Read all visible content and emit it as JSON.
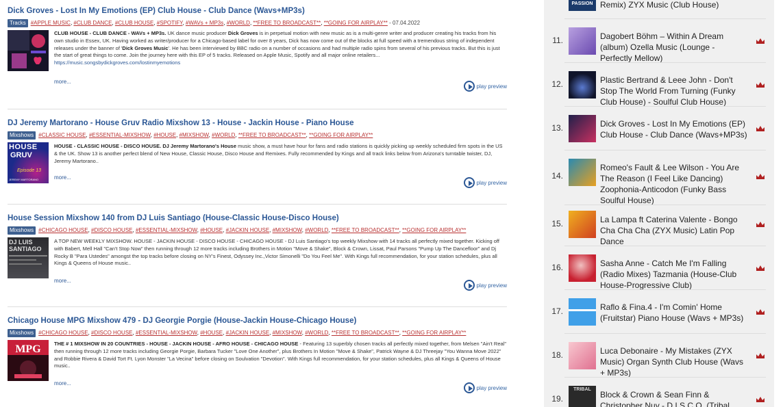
{
  "posts": [
    {
      "title": "Dick Groves - Lost In My Emotions (EP) Club House - Club Dance (Wavs+MP3s)",
      "category": "Tracks",
      "tags": [
        "#APPLE MUSIC",
        "#CLUB DANCE",
        "#CLUB HOUSE",
        "#SPOTIFY",
        "#WAVs + MP3s",
        "#WORLD",
        "**FREE TO BROADCAST**",
        "**GOING FOR AIRPLAY**"
      ],
      "date": "- 07.04.2022",
      "desc_lead": "CLUB HOUSE - CLUB DANCE - WAVs + MP3s.",
      "desc_body_a": " UK dance music producer ",
      "desc_bold_b": "Dick Groves",
      "desc_body_c": " is in perpetual motion with new music as is a multi-genre writer and producer creating his tracks from his own studio in Essex, UK. Having worked as writer/producer for a Chicago-based label for over 8 years, Dick has now come out of the blocks at full speed with a tremendous string of independent releases under the banner of '",
      "desc_bold_d": "Dick Groves Music",
      "desc_body_e": "'. He has been interviewed by BBC radio on a number of occasions and had multiple radio spins from several of his previous tracks. But this is just the start of great things to come. Join the journey here with this EP of 5 tracks. Released on Apple Music, Spotify and all major online retailers...",
      "link": "https://music.songsbydickgroves.com/lostinmyemotions",
      "more": "more...",
      "play": "play preview"
    },
    {
      "title": "DJ Jeremy Martorano - House Gruv Radio Mixshow 13 - House - Jackin House - Piano House",
      "category": "Mixshows",
      "tags": [
        "#CLASSIC HOUSE",
        "#ESSENTIAL-MIXSHOW",
        "#HOUSE",
        "#MIXSHOW",
        "#WORLD",
        "**FREE TO BROADCAST**",
        "**GOING FOR AIRPLAY**"
      ],
      "desc_lead": "HOUSE - CLASSIC HOUSE - DISCO HOUSE. DJ Jeremy Martorano's House",
      "desc_body": " music show, a must have hour for fans and radio stations is quickly picking up weekly scheduled firm spots in the US & the UK. Show 13 is another perfect blend of New House, Classic House, Disco House and Remixes. Fully recommended by Kings and all track links below from Arizona's turntable twister, DJ, Jeremy Martorano..",
      "thumb_title": "HOUSE",
      "thumb_sub": "GRUV",
      "thumb_ep": "Episode 13",
      "thumb_name": "JEREMY MARTORANO",
      "more": "more...",
      "play": "play preview"
    },
    {
      "title": "House Session Mixshow 140 from DJ Luis Santiago (House-Classic House-Disco House)",
      "category": "Mixshows",
      "tags": [
        "#CHICAGO HOUSE",
        "#DISCO HOUSE",
        "#ESSENTIAL-MIXSHOW",
        "#HOUSE",
        "#JACKIN HOUSE",
        "#MIXSHOW",
        "#WORLD",
        "**FREE TO BROADCAST**",
        "**GOING FOR AIRPLAY**"
      ],
      "desc": "A TOP NEW WEEKLY MIXSHOW. HOUSE - JACKIN HOUSE - DISCO HOUSE - CHICAGO HOUSE - DJ Luis Santiago's top weekly Mixshow with 14 tracks all perfectly mixed together. Kicking off with Babert, Mell Hall \"Can't Stop Now\" then running through 12 more tracks including Brothers in Motion \"Move & Shake\", Block & Crown, Lissat, Paul Parsons \"Pump Up The Dancefloor\" and Dj Rocky B \"Para Ustedes\" amongst the top tracks before closing on NY's Finest, Odyssey Inc.,Victor Simonelli \"Do You Feel Me\". With Kings full recommendation, for your station schedules, plus all Kings & Queens of House music..",
      "thumb_title": "DJ LUIS",
      "thumb_sub": "SANTIAGO",
      "more": "more...",
      "play": "play preview"
    },
    {
      "title": "Chicago House MPG Mixshow 479 - DJ Georgie Porgie (House-Jackin House-Chicago House)",
      "category": "Mixshows",
      "tags": [
        "#CHICAGO HOUSE",
        "#DISCO HOUSE",
        "#ESSENTIAL-MIXSHOW",
        "#HOUSE",
        "#JACKIN HOUSE",
        "#MIXSHOW",
        "#WORLD",
        "**FREE TO BROADCAST**",
        "**GOING FOR AIRPLAY**"
      ],
      "desc_lead": "THE # 1 MIXSHOW IN 20 COUNTRIES - HOUSE - JACKIN HOUSE - AFRO HOUSE - CHICAGO HOUSE",
      "desc_body": " - Featuring 13 superbly chosen tracks all perfectly mixed together, from Melsen \"Ain't Real\" then running through 12 more tracks including Georgie Porgie, Barbara Tucker \"Love One Another\", plus Brothers In Motion \"Move & Shake\", Patrick Wayne & DJ Threejay \"You Wanna Move 2022\" and Robbie Rivera & David Tort Ft. Lyon Monster \"La Vecina\" before closing on Soulvation \"Devotion\". With Kings full recommendation, for your station schedules, plus all Kings & Queens of House music..",
      "more": "more...",
      "play": "play preview"
    }
  ],
  "chart": {
    "top_partial": {
      "title": "Remix) ZYX Music (Club House)",
      "thumb_label": "PASSION"
    },
    "items": [
      {
        "rank": "11.",
        "title": "Dagobert Böhm – Within A Dream (album) Ozella Music (Lounge - Perfectly Mellow)"
      },
      {
        "rank": "12.",
        "title": "Plastic Bertrand & Leee John - Don't Stop The World From Turning (Funky Club House) - Soulful Club House)"
      },
      {
        "rank": "13.",
        "title": "Dick Groves - Lost In My Emotions (EP) Club House - Club Dance (Wavs+MP3s)"
      },
      {
        "rank": "14.",
        "title": "Romeo's Fault & Lee Wilson - You Are The Reason (I Feel Like Dancing) Zoophonia-Anticodon (Funky Bass Soulful House)"
      },
      {
        "rank": "15.",
        "title": "La Lampa ft Caterina Valente - Bongo Cha Cha Cha (ZYX Music) Latin Pop Dance"
      },
      {
        "rank": "16.",
        "title": "Sasha Anne - Catch Me I'm Falling (Radio Mixes) Tazmania (House-Club House-Progressive Club)"
      },
      {
        "rank": "17.",
        "title": "Raflo & Fina.4 - I'm Comin' Home (Fruitstar) Piano House (Wavs + MP3s)"
      },
      {
        "rank": "18.",
        "title": "Luca Debonaire - My Mistakes (ZYX Music) Organ Synth Club House (Wavs + MP3s)"
      },
      {
        "rank": "19.",
        "title": "Block & Crown & Sean Finn & Christopher Nuv - D.I.S.C.O. (Tribal"
      },
      {
        "thumb_label": "TRIBAL"
      }
    ]
  },
  "colors": {
    "title_blue": "#2b5795",
    "tag_red": "#b83030",
    "crown_red": "#b02020",
    "sidebar_bg": "#f0f0f0"
  }
}
